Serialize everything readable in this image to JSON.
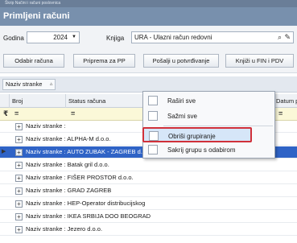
{
  "window": {
    "top_strip_text": "Škrip  Načini i računi poslovnica",
    "title": "Primljeni računi"
  },
  "filters": {
    "year_label": "Godina",
    "year_value": "2024",
    "book_label": "Knjiga",
    "book_value": "URA - Ulazni račun redovni",
    "search_icon": "search-icon",
    "edit_icon": "pencil-icon"
  },
  "toolbar": {
    "buttons": [
      "Odabir računa",
      "Priprema za PP",
      "Pošalji u potvrđivanje",
      "Knjiži u FIN i PDV"
    ]
  },
  "grouping": {
    "tag_label": "Naziv stranke",
    "sort_icon": "sort-arrow-icon"
  },
  "grid": {
    "columns": [
      "Broj",
      "Status računa",
      "Datum p"
    ],
    "filter_placeholder": "="
  },
  "rows": [
    "Naziv stranke :",
    "Naziv stranke : ALPHA-M d.o.o.",
    "Naziv stranke : AUTO ZUBAK - ZAGREB d.o.o.",
    "Naziv stranke : Batak gril d.o.o.",
    "Naziv stranke : FIŠER PROSTOR d.o.o.",
    "Naziv stranke : GRAD ZAGREB",
    "Naziv stranke : HEP-Operator distribucijskog",
    "Naziv stranke : IKEA SRBIJA DOO BEOGRAD",
    "Naziv stranke : Jezero d.o.o."
  ],
  "selected_row_index": 2,
  "context_menu": {
    "items": [
      "Raširi sve",
      "Sažmi sve",
      "Obriši grupiranje",
      "Sakrij grupu s odabirom"
    ],
    "highlighted_index": 2
  }
}
